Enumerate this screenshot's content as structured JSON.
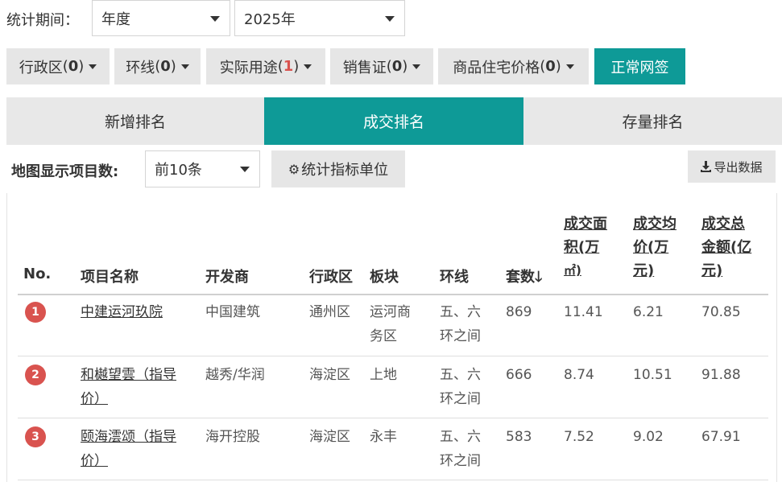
{
  "period": {
    "label": "统计期间：",
    "type": "年度",
    "year": "2025年"
  },
  "filters": [
    {
      "name": "行政区",
      "count": "0",
      "highlight": false
    },
    {
      "name": "环线",
      "count": "0",
      "highlight": false
    },
    {
      "name": "实际用途",
      "count": "1",
      "highlight": true
    },
    {
      "name": "销售证",
      "count": "0",
      "highlight": false
    },
    {
      "name": "商品住宅价格",
      "count": "0",
      "highlight": false
    }
  ],
  "normal_sign": "正常网签",
  "tabs": [
    "新增排名",
    "成交排名",
    "存量排名"
  ],
  "active_tab": 1,
  "map_display": {
    "label": "地图显示项目数:",
    "value": "前10条"
  },
  "unit_button": "统计指标单位",
  "export_button": "导出数据",
  "table": {
    "headers": {
      "no": "No.",
      "name": "项目名称",
      "developer": "开发商",
      "district": "行政区",
      "block": "板块",
      "ring": "环线",
      "units": "套数",
      "area_l1": "成交面",
      "area_l2": "积(万",
      "area_l3": "㎡)",
      "avg_l1": "成交均",
      "avg_l2": "价(万",
      "avg_l3": "元)",
      "total_l1": "成交总",
      "total_l2": "金额(亿",
      "total_l3": "元)"
    },
    "rows": [
      {
        "rank": "1",
        "name_l1": "中建运河玖院",
        "name_l2": "",
        "developer": "中国建筑",
        "district": "通州区",
        "block_l1": "运河商",
        "block_l2": "务区",
        "ring_l1": "五、六",
        "ring_l2": "环之间",
        "units": "869",
        "area": "11.41",
        "avg": "6.21",
        "total": "70.85"
      },
      {
        "rank": "2",
        "name_l1": "和樾望雲（指导",
        "name_l2": "价）",
        "developer": "越秀/华润",
        "district": "海淀区",
        "block_l1": "上地",
        "block_l2": "",
        "ring_l1": "五、六",
        "ring_l2": "环之间",
        "units": "666",
        "area": "8.74",
        "avg": "10.51",
        "total": "91.88"
      },
      {
        "rank": "3",
        "name_l1": "颐海澐颂（指导",
        "name_l2": "价）",
        "developer": "海开控股",
        "district": "海淀区",
        "block_l1": "永丰",
        "block_l2": "",
        "ring_l1": "五、六",
        "ring_l2": "环之间",
        "units": "583",
        "area": "7.52",
        "avg": "9.02",
        "total": "67.91"
      }
    ]
  },
  "colors": {
    "accent": "#0e9a97",
    "rank_badge": "#d9534f",
    "button_bg": "#e6e6e6"
  }
}
